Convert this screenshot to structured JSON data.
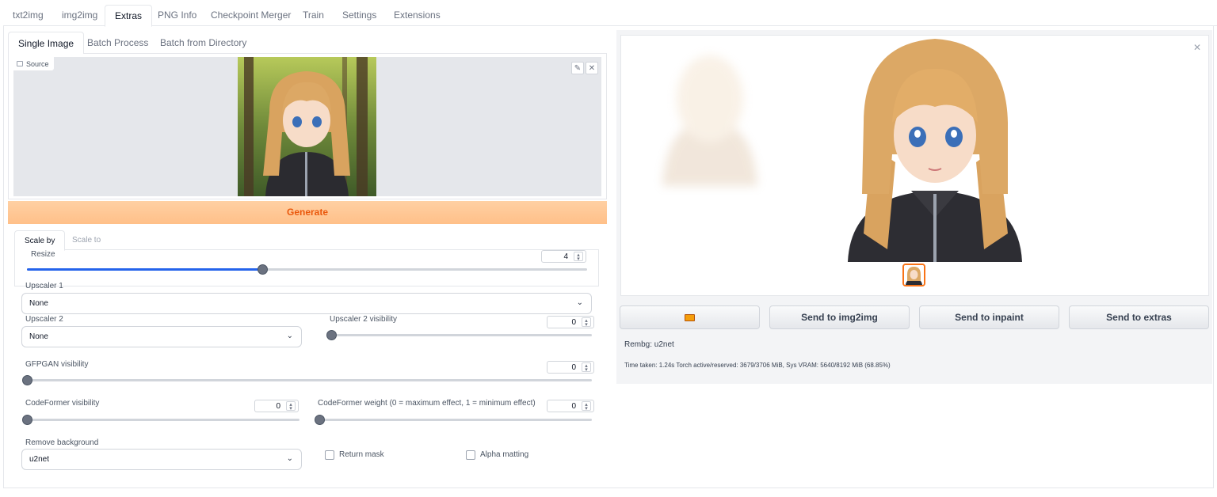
{
  "top_tabs": [
    "txt2img",
    "img2img",
    "Extras",
    "PNG Info",
    "Checkpoint Merger",
    "Train",
    "Settings",
    "Extensions"
  ],
  "active_top_tab": "Extras",
  "sub_tabs": [
    "Single Image",
    "Batch Process",
    "Batch from Directory"
  ],
  "source_label": "Source",
  "generate_label": "Generate",
  "scale_tabs": [
    "Scale by",
    "Scale to"
  ],
  "resize": {
    "label": "Resize",
    "value": "4",
    "fraction": 0.42
  },
  "upscaler1": {
    "label": "Upscaler 1",
    "value": "None"
  },
  "upscaler2": {
    "label": "Upscaler 2",
    "value": "None"
  },
  "upscaler2_visibility": {
    "label": "Upscaler 2 visibility",
    "value": "0"
  },
  "gfpgan": {
    "label": "GFPGAN visibility",
    "value": "0"
  },
  "codeformer_visibility": {
    "label": "CodeFormer visibility",
    "value": "0"
  },
  "codeformer_weight": {
    "label": "CodeFormer weight (0 = maximum effect, 1 = minimum effect)",
    "value": "0"
  },
  "remove_bg": {
    "label": "Remove background",
    "value": "u2net"
  },
  "return_mask": "Return mask",
  "alpha_matting": "Alpha matting",
  "actions": {
    "folder_icon": "folder-icon",
    "send_img2img": "Send to img2img",
    "send_inpaint": "Send to inpaint",
    "send_extras": "Send to extras"
  },
  "info": {
    "rembg": "Rembg: u2net",
    "time": "Time taken: 1.24s  Torch active/reserved: 3679/3706 MiB, Sys VRAM: 5640/8192 MiB (68.85%)"
  },
  "colors": {
    "accent": "#2563eb",
    "generate_text": "#ea580c",
    "generate_bg": "#ffc089",
    "selected_thumb": "#f97316"
  }
}
